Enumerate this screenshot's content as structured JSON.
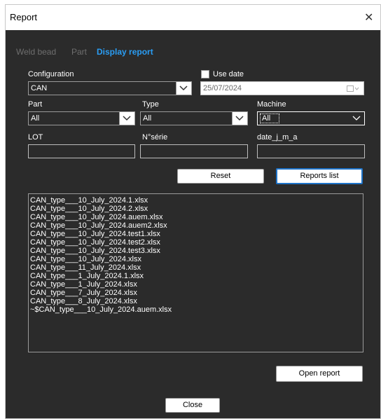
{
  "window": {
    "title": "Report",
    "close_glyph": "✕"
  },
  "tabs": [
    {
      "label": "Weld bead"
    },
    {
      "label": "Part"
    },
    {
      "label": "Display report"
    }
  ],
  "config": {
    "label": "Configuration",
    "value": "CAN"
  },
  "use_date": {
    "label": "Use date",
    "checked": false,
    "value": "25/07/2024"
  },
  "part": {
    "label": "Part",
    "value": "All"
  },
  "type": {
    "label": "Type",
    "value": "All"
  },
  "machine": {
    "label": "Machine",
    "value": "All"
  },
  "lot": {
    "label": "LOT",
    "value": ""
  },
  "serial": {
    "label": "N°série",
    "value": ""
  },
  "date_jma": {
    "label": "date_j_m_a",
    "value": ""
  },
  "buttons": {
    "reset": "Reset",
    "reports_list": "Reports list",
    "open_report": "Open report",
    "close": "Close"
  },
  "reports": [
    "CAN_type___10_July_2024.1.xlsx",
    "CAN_type___10_July_2024.2.xlsx",
    "CAN_type___10_July_2024.auem.xlsx",
    "CAN_type___10_July_2024.auem2.xlsx",
    "CAN_type___10_July_2024.test1.xlsx",
    "CAN_type___10_July_2024.test2.xlsx",
    "CAN_type___10_July_2024.test3.xlsx",
    "CAN_type___10_July_2024.xlsx",
    "CAN_type___11_July_2024.xlsx",
    "CAN_type___1_July_2024.1.xlsx",
    "CAN_type___1_July_2024.xlsx",
    "CAN_type___7_July_2024.xlsx",
    "CAN_type___8_July_2024.xlsx",
    "~$CAN_type___10_July_2024.auem.xlsx"
  ]
}
